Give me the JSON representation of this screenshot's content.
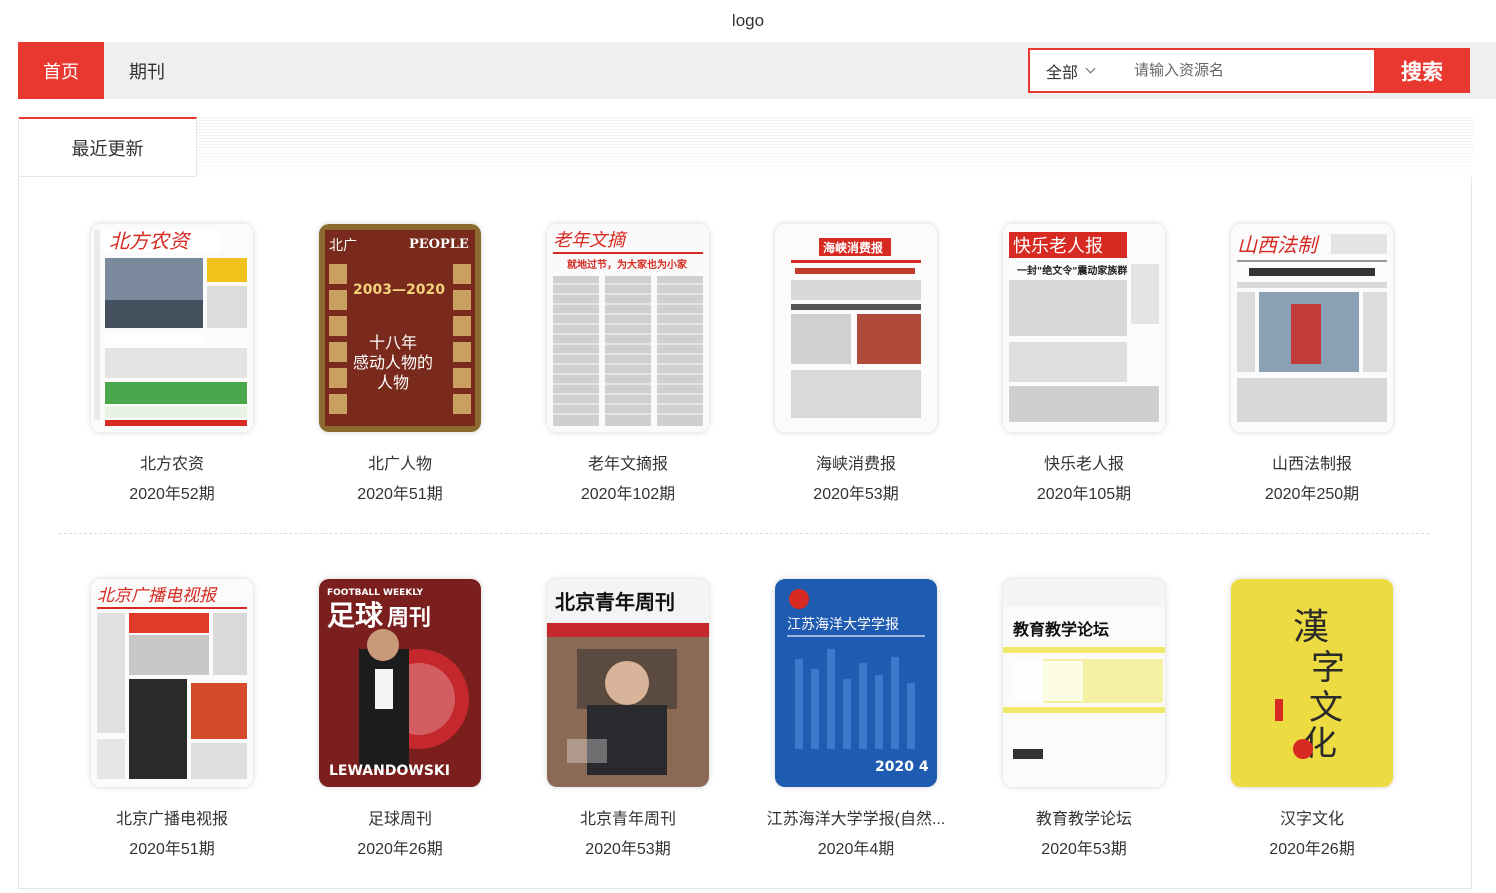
{
  "header": {
    "logo_text": "logo"
  },
  "nav": {
    "tabs": [
      {
        "label": "首页"
      },
      {
        "label": "期刊"
      }
    ]
  },
  "search": {
    "scope": "全部",
    "placeholder": "请输入资源名",
    "button_label": "搜索"
  },
  "section": {
    "tab_label": "最近更新"
  },
  "items": [
    {
      "title": "北方农资",
      "issue": "2020年52期"
    },
    {
      "title": "北广人物",
      "issue": "2020年51期"
    },
    {
      "title": "老年文摘报",
      "issue": "2020年102期"
    },
    {
      "title": "海峡消费报",
      "issue": "2020年53期"
    },
    {
      "title": "快乐老人报",
      "issue": "2020年105期"
    },
    {
      "title": "山西法制报",
      "issue": "2020年250期"
    },
    {
      "title": "北京广播电视报",
      "issue": "2020年51期"
    },
    {
      "title": "足球周刊",
      "issue": "2020年26期"
    },
    {
      "title": "北京青年周刊",
      "issue": "2020年53期"
    },
    {
      "title": "江苏海洋大学学报(自然...",
      "issue": "2020年4期"
    },
    {
      "title": "教育教学论坛",
      "issue": "2020年53期"
    },
    {
      "title": "汉字文化",
      "issue": "2020年26期"
    }
  ],
  "colors": {
    "accent": "#e8382f",
    "nav_bg": "#efefef"
  }
}
